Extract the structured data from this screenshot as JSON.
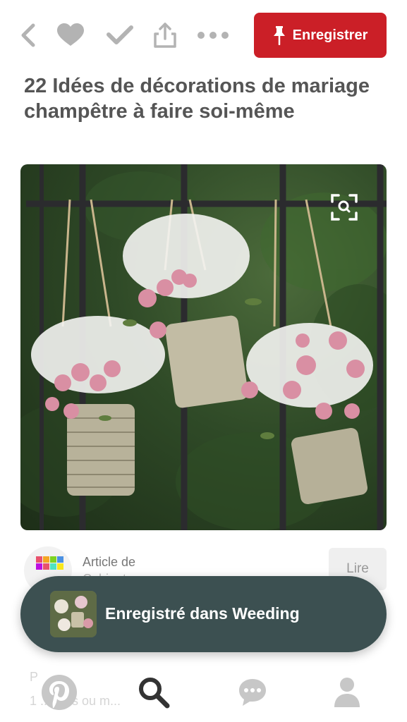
{
  "toolbar": {
    "back_icon": "chevron-left-icon",
    "like_icon": "heart-icon",
    "done_icon": "checkmark-icon",
    "share_icon": "share-icon",
    "more_icon": "more-dots-icon",
    "save_label": "Enregistrer",
    "save_color": "#cb1f27"
  },
  "pin": {
    "title": "22 Idées de décorations de mariage champêtre à faire soi-même",
    "image_alt_icon": "visual-search-icon"
  },
  "source": {
    "label": "Article de",
    "name": "Cabinet..",
    "read_label": "Lire"
  },
  "toast": {
    "text": "Enregistré dans Weeding",
    "color": "#3c5051"
  },
  "peek": {
    "line1": "P",
    "line2": "1 ... ntes ou m..."
  },
  "nav": {
    "home_icon": "pinterest-logo-icon",
    "search_icon": "search-icon",
    "messages_icon": "chat-bubble-icon",
    "profile_icon": "person-icon"
  }
}
